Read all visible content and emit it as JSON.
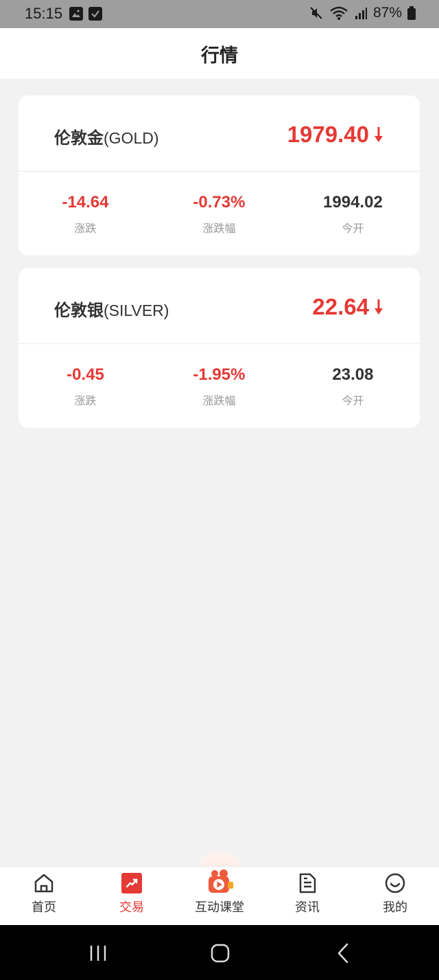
{
  "status_bar": {
    "time": "15:15",
    "battery": "87%"
  },
  "header": {
    "title": "行情"
  },
  "quotes": [
    {
      "name_cn": "伦敦金",
      "name_en": "(GOLD)",
      "price": "1979.40",
      "change": "-14.64",
      "change_label": "涨跌",
      "change_pct": "-0.73%",
      "change_pct_label": "涨跌幅",
      "open": "1994.02",
      "open_label": "今开"
    },
    {
      "name_cn": "伦敦银",
      "name_en": "(SILVER)",
      "price": "22.64",
      "change": "-0.45",
      "change_label": "涨跌",
      "change_pct": "-1.95%",
      "change_pct_label": "涨跌幅",
      "open": "23.08",
      "open_label": "今开"
    }
  ],
  "bottom_nav": {
    "items": [
      {
        "label": "首页",
        "icon": "home-icon"
      },
      {
        "label": "交易",
        "icon": "trade-icon"
      },
      {
        "label": "互动课堂",
        "icon": "video-class-icon"
      },
      {
        "label": "资讯",
        "icon": "document-icon"
      },
      {
        "label": "我的",
        "icon": "smiley-icon"
      }
    ],
    "active_index": 1
  },
  "colors": {
    "accent": "#e53935",
    "background": "#f2f2f2",
    "card": "#ffffff",
    "status_bar": "#9e9e9e"
  }
}
